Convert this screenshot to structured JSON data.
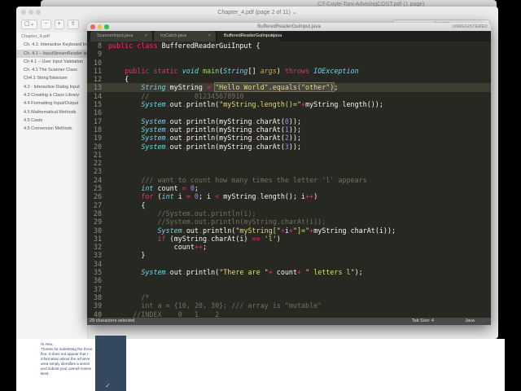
{
  "back_window": {
    "title": "CT-Coyle-Toni-AdvisingCOST.pdf (1 page)"
  },
  "pdf_viewer": {
    "title": "Chapter_4.pdf (page 2 of 11) ⌄",
    "search_placeholder": "Search",
    "toolbar": [
      "▢⌄",
      "−",
      "+",
      "⇧"
    ],
    "sidebar": {
      "root": "Chapter_4.pdf",
      "items": [
        {
          "label": "Ch. 4.1: Interactive Keyboard Input",
          "selected": false
        },
        {
          "label": "Ch. 4.1 – InputStreamReader and BufferedReader",
          "selected": true
        },
        {
          "label": "Ch 4.1 – User Input Validation",
          "selected": false
        },
        {
          "label": "Ch. 4.1 The Scanner Class",
          "selected": false
        },
        {
          "label": "Ch4.1 StringTokenizer",
          "selected": false
        },
        {
          "label": "4.2 - Interactive Dialog Input",
          "selected": false
        },
        {
          "label": "4.3 Creating a Class Library",
          "selected": false
        },
        {
          "label": "4.4 Formatting Input/Output",
          "selected": false
        },
        {
          "label": "4.5 Mathematical Methods",
          "selected": false
        },
        {
          "label": "4.5 Casts",
          "selected": false
        },
        {
          "label": "4.5 Conversion Methods",
          "selected": false
        }
      ]
    }
  },
  "editor": {
    "title": "BufferedReaderGuiInput.java",
    "unregistered": "UNREGISTERED",
    "tabs": [
      {
        "label": "ScannerInput.java",
        "active": false,
        "close": "×"
      },
      {
        "label": "tryCatch.java",
        "active": false,
        "close": "×"
      },
      {
        "label": "BufferedReaderGuiInput.java",
        "active": true,
        "close": "●"
      }
    ],
    "current_line": 13,
    "lines": [
      {
        "n": 8,
        "t": [
          [
            "k",
            "public "
          ],
          [
            "k",
            "class "
          ],
          [
            "p",
            "BufferedReaderGuiInput {"
          ]
        ]
      },
      {
        "n": 9,
        "t": []
      },
      {
        "n": 10,
        "t": []
      },
      {
        "n": 11,
        "t": [
          [
            "p",
            "    "
          ],
          [
            "k",
            "public static "
          ],
          [
            "t",
            "void "
          ],
          [
            "f",
            "main"
          ],
          [
            "p",
            "("
          ],
          [
            "t",
            "String"
          ],
          [
            "p",
            "[] "
          ],
          [
            "a",
            "args"
          ],
          [
            "p",
            ") "
          ],
          [
            "k",
            "throws "
          ],
          [
            "t",
            "IOException"
          ]
        ]
      },
      {
        "n": 12,
        "t": [
          [
            "p",
            "    {"
          ]
        ]
      },
      {
        "n": 13,
        "t": [
          [
            "p",
            "        "
          ],
          [
            "t",
            "String "
          ],
          [
            "p",
            "myString "
          ],
          [
            "o",
            "= "
          ],
          [
            "h",
            "\"Hello World\".equals(\"other\")"
          ],
          [
            "p",
            ";"
          ]
        ]
      },
      {
        "n": 14,
        "t": [
          [
            "p",
            "        "
          ],
          [
            "c",
            "//           012345678910"
          ]
        ]
      },
      {
        "n": 15,
        "t": [
          [
            "p",
            "        "
          ],
          [
            "t",
            "System"
          ],
          [
            "o",
            "."
          ],
          [
            "p",
            "out"
          ],
          [
            "o",
            "."
          ],
          [
            "p",
            "println("
          ],
          [
            "s",
            "\"myString.length()=\""
          ],
          [
            "o",
            "+"
          ],
          [
            "p",
            "myString"
          ],
          [
            "o",
            "."
          ],
          [
            "p",
            "length());"
          ]
        ]
      },
      {
        "n": 16,
        "t": []
      },
      {
        "n": 17,
        "t": [
          [
            "p",
            "        "
          ],
          [
            "t",
            "System"
          ],
          [
            "o",
            "."
          ],
          [
            "p",
            "out"
          ],
          [
            "o",
            "."
          ],
          [
            "p",
            "println(myString"
          ],
          [
            "o",
            "."
          ],
          [
            "p",
            "charAt("
          ],
          [
            "n",
            "0"
          ],
          [
            "p",
            "));"
          ]
        ]
      },
      {
        "n": 18,
        "t": [
          [
            "p",
            "        "
          ],
          [
            "t",
            "System"
          ],
          [
            "o",
            "."
          ],
          [
            "p",
            "out"
          ],
          [
            "o",
            "."
          ],
          [
            "p",
            "println(myString"
          ],
          [
            "o",
            "."
          ],
          [
            "p",
            "charAt("
          ],
          [
            "n",
            "1"
          ],
          [
            "p",
            "));"
          ]
        ]
      },
      {
        "n": 19,
        "t": [
          [
            "p",
            "        "
          ],
          [
            "t",
            "System"
          ],
          [
            "o",
            "."
          ],
          [
            "p",
            "out"
          ],
          [
            "o",
            "."
          ],
          [
            "p",
            "println(myString"
          ],
          [
            "o",
            "."
          ],
          [
            "p",
            "charAt("
          ],
          [
            "n",
            "2"
          ],
          [
            "p",
            "));"
          ]
        ]
      },
      {
        "n": 20,
        "t": [
          [
            "p",
            "        "
          ],
          [
            "t",
            "System"
          ],
          [
            "o",
            "."
          ],
          [
            "p",
            "out"
          ],
          [
            "o",
            "."
          ],
          [
            "p",
            "println(myString"
          ],
          [
            "o",
            "."
          ],
          [
            "p",
            "charAt("
          ],
          [
            "n",
            "3"
          ],
          [
            "p",
            "));"
          ]
        ]
      },
      {
        "n": 21,
        "t": []
      },
      {
        "n": 22,
        "t": []
      },
      {
        "n": 23,
        "t": []
      },
      {
        "n": 24,
        "t": [
          [
            "p",
            "        "
          ],
          [
            "c",
            "/// want to count how many times the letter 'l' appears"
          ]
        ]
      },
      {
        "n": 25,
        "t": [
          [
            "p",
            "        "
          ],
          [
            "t",
            "int "
          ],
          [
            "p",
            "count "
          ],
          [
            "o",
            "= "
          ],
          [
            "n",
            "0"
          ],
          [
            "p",
            ";"
          ]
        ]
      },
      {
        "n": 26,
        "t": [
          [
            "p",
            "        "
          ],
          [
            "k",
            "for "
          ],
          [
            "p",
            "("
          ],
          [
            "t",
            "int "
          ],
          [
            "p",
            "i "
          ],
          [
            "o",
            "= "
          ],
          [
            "n",
            "0"
          ],
          [
            "p",
            "; i "
          ],
          [
            "o",
            "< "
          ],
          [
            "p",
            "myString"
          ],
          [
            "o",
            "."
          ],
          [
            "p",
            "length(); i"
          ],
          [
            "o",
            "++"
          ],
          [
            "p",
            ")"
          ]
        ]
      },
      {
        "n": 27,
        "t": [
          [
            "p",
            "        {"
          ]
        ]
      },
      {
        "n": 28,
        "t": [
          [
            "p",
            "            "
          ],
          [
            "c",
            "//System.out.println(i);"
          ]
        ]
      },
      {
        "n": 29,
        "t": [
          [
            "p",
            "            "
          ],
          [
            "c",
            "//System.out.println(myString.charAt(i));"
          ]
        ]
      },
      {
        "n": 30,
        "t": [
          [
            "p",
            "            "
          ],
          [
            "t",
            "System"
          ],
          [
            "o",
            "."
          ],
          [
            "p",
            "out"
          ],
          [
            "o",
            "."
          ],
          [
            "p",
            "println("
          ],
          [
            "s",
            "\"myString[\""
          ],
          [
            "o",
            "+"
          ],
          [
            "p",
            "i"
          ],
          [
            "o",
            "+"
          ],
          [
            "s",
            "\"]=\""
          ],
          [
            "o",
            "+"
          ],
          [
            "p",
            "myString"
          ],
          [
            "o",
            "."
          ],
          [
            "p",
            "charAt(i));"
          ]
        ]
      },
      {
        "n": 31,
        "t": [
          [
            "p",
            "            "
          ],
          [
            "k",
            "if "
          ],
          [
            "p",
            "(myString"
          ],
          [
            "o",
            "."
          ],
          [
            "p",
            "charAt(i) "
          ],
          [
            "o",
            "== "
          ],
          [
            "s",
            "'l'"
          ],
          [
            "p",
            ")"
          ]
        ]
      },
      {
        "n": 32,
        "t": [
          [
            "p",
            "                count"
          ],
          [
            "o",
            "++"
          ],
          [
            "p",
            ";"
          ]
        ]
      },
      {
        "n": 33,
        "t": [
          [
            "p",
            "        }"
          ]
        ]
      },
      {
        "n": 34,
        "t": []
      },
      {
        "n": 35,
        "t": [
          [
            "p",
            "        "
          ],
          [
            "t",
            "System"
          ],
          [
            "o",
            "."
          ],
          [
            "p",
            "out"
          ],
          [
            "o",
            "."
          ],
          [
            "p",
            "println("
          ],
          [
            "s",
            "\"There are \""
          ],
          [
            "o",
            "+ "
          ],
          [
            "p",
            "count"
          ],
          [
            "o",
            "+ "
          ],
          [
            "s",
            "\" letters l\""
          ],
          [
            "p",
            ");"
          ]
        ]
      },
      {
        "n": 36,
        "t": []
      },
      {
        "n": 37,
        "t": []
      },
      {
        "n": 38,
        "t": [
          [
            "p",
            "        "
          ],
          [
            "c",
            "/*"
          ]
        ]
      },
      {
        "n": 39,
        "t": [
          [
            "p",
            "        "
          ],
          [
            "c",
            "int a = {10, 20, 30}; /// array is \"mutable\""
          ]
        ]
      },
      {
        "n": 40,
        "t": [
          [
            "p",
            "      "
          ],
          [
            "c",
            "//INDEX    0   1    2"
          ]
        ]
      }
    ],
    "status": {
      "selection": "29 characters selected",
      "tab_size": "Tab Size: 4",
      "syntax": "Java"
    }
  },
  "email": {
    "lines": [
      "Hi Alex,",
      "Thanks for submitting the three",
      "flex:  It does not appear that t",
      "information about the achieve",
      "area simply identifies a series",
      "and submit your overall review",
      "Best,"
    ]
  },
  "panel": {
    "glyph": "✓"
  }
}
